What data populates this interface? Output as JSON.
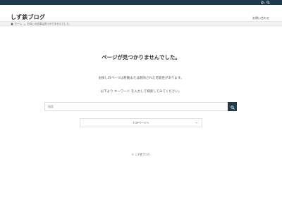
{
  "topbar": {
    "icons": [
      "rss-icon",
      "search-icon"
    ],
    "color": "#1f3a4b"
  },
  "header": {
    "site_title": "しず鉄ブログ",
    "contact_label": "お問い合わせ"
  },
  "breadcrumb": {
    "home_label": "ホーム",
    "separator": ">",
    "current_label": "お探しの記事は見つかりませんでした。"
  },
  "main": {
    "heading": "ページが見つかりませんでした。",
    "message_1": "お探しのページは移動または削除された可能性があります。",
    "message_2": "以下より キーワード を入力して検索してみてください。",
    "search": {
      "placeholder": "検索"
    },
    "top_button_label": "TOPページへ",
    "top_button_arrow": "→"
  },
  "footer": {
    "copyright": "© しず鉄ブログ."
  }
}
